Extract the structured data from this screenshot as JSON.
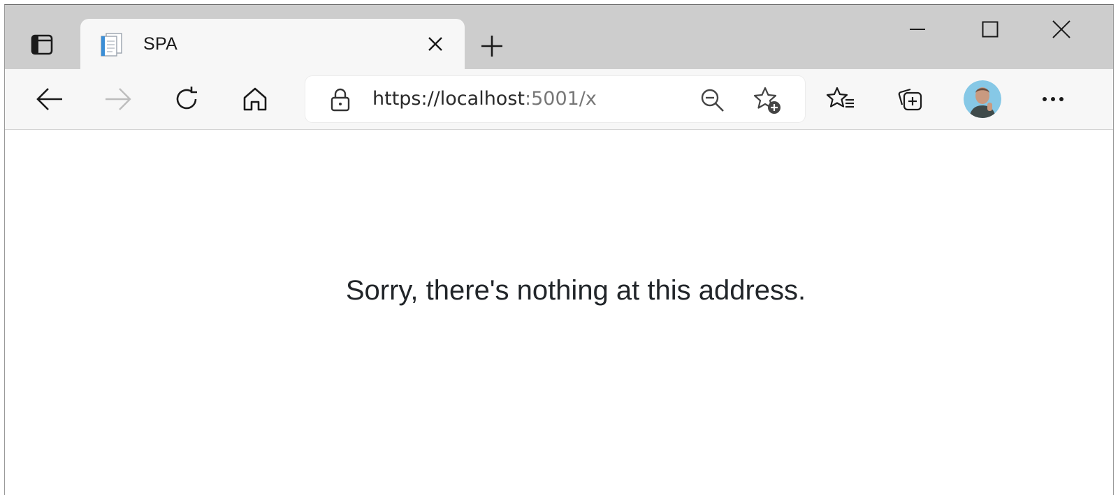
{
  "browser": {
    "tabs": [
      {
        "title": "SPA",
        "favicon": "document-icon"
      }
    ],
    "icons": {
      "tab_actions": "tab-actions-icon",
      "tab_close": "close-icon",
      "new_tab": "plus-icon",
      "minimize": "minimize-icon",
      "maximize": "maximize-icon",
      "close_window": "close-icon",
      "back": "back-arrow-icon",
      "forward": "forward-arrow-icon",
      "refresh": "refresh-icon",
      "home": "home-icon",
      "lock": "lock-icon",
      "zoom_out": "zoom-out-icon",
      "add_favorite": "star-add-icon",
      "favorites": "favorites-icon",
      "collections": "collections-icon",
      "profile": "avatar",
      "more": "more-icon"
    },
    "address_bar": {
      "url_host": "https://localhost",
      "url_rest": ":5001/x"
    }
  },
  "page": {
    "message": "Sorry, there's nothing at this address."
  },
  "colors": {
    "tabstrip_bg": "#cdcdcd",
    "toolbar_bg": "#f7f7f7",
    "text_dark": "#212529",
    "forward_disabled": "#bdbdbd"
  }
}
